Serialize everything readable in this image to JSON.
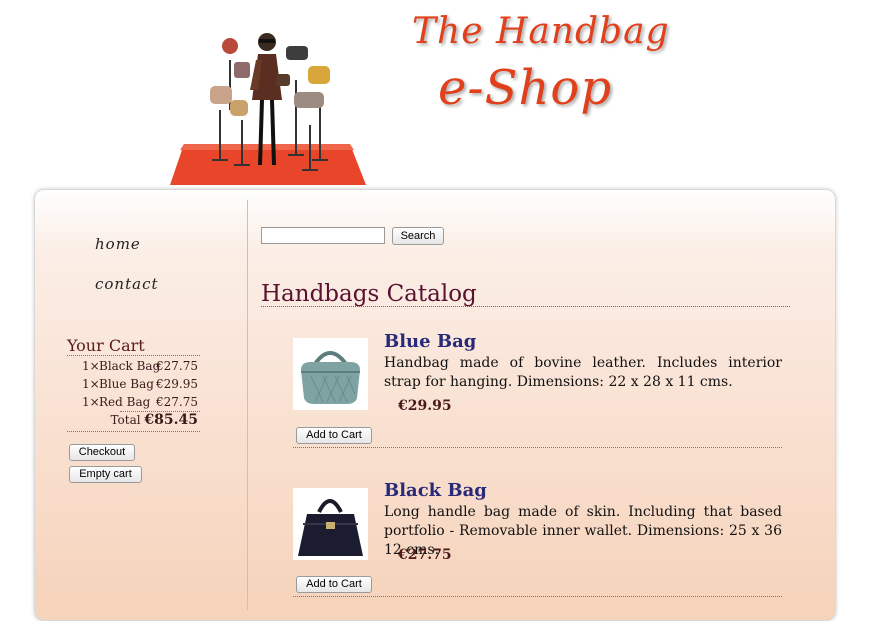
{
  "header": {
    "banner_icon": "fashion-illustration",
    "title_line1": "The Handbag",
    "title_line2": "e-Shop",
    "title_color": "#e0401b"
  },
  "nav": {
    "home": "home",
    "contact": "contact"
  },
  "cart": {
    "title": "Your Cart",
    "items": [
      {
        "qty": "1×",
        "name": "Black Bag",
        "price": "€27.75"
      },
      {
        "qty": "1×",
        "name": "Blue Bag",
        "price": "€29.95"
      },
      {
        "qty": "1×",
        "name": "Red Bag",
        "price": "€27.75"
      }
    ],
    "total_label": "Total",
    "total_value": "€85.45",
    "checkout_label": "Checkout",
    "empty_label": "Empty cart"
  },
  "search": {
    "value": "",
    "button_label": "Search"
  },
  "catalog": {
    "title": "Handbags Catalog",
    "products": [
      {
        "name": "Blue Bag",
        "description": "Handbag made of bovine leather. Includes interior strap for hanging. Dimensions: 22 x 28 x 11 cms.",
        "price": "€29.95",
        "button_label": "Add to Cart",
        "image": "blue-bag-image"
      },
      {
        "name": "Black Bag",
        "description": "Long handle bag made of skin. Including that based portfolio - Removable inner wallet. Dimensions: 25 x 36 12 cms.",
        "price": "€27.75",
        "button_label": "Add to Cart",
        "image": "black-bag-image"
      }
    ]
  }
}
